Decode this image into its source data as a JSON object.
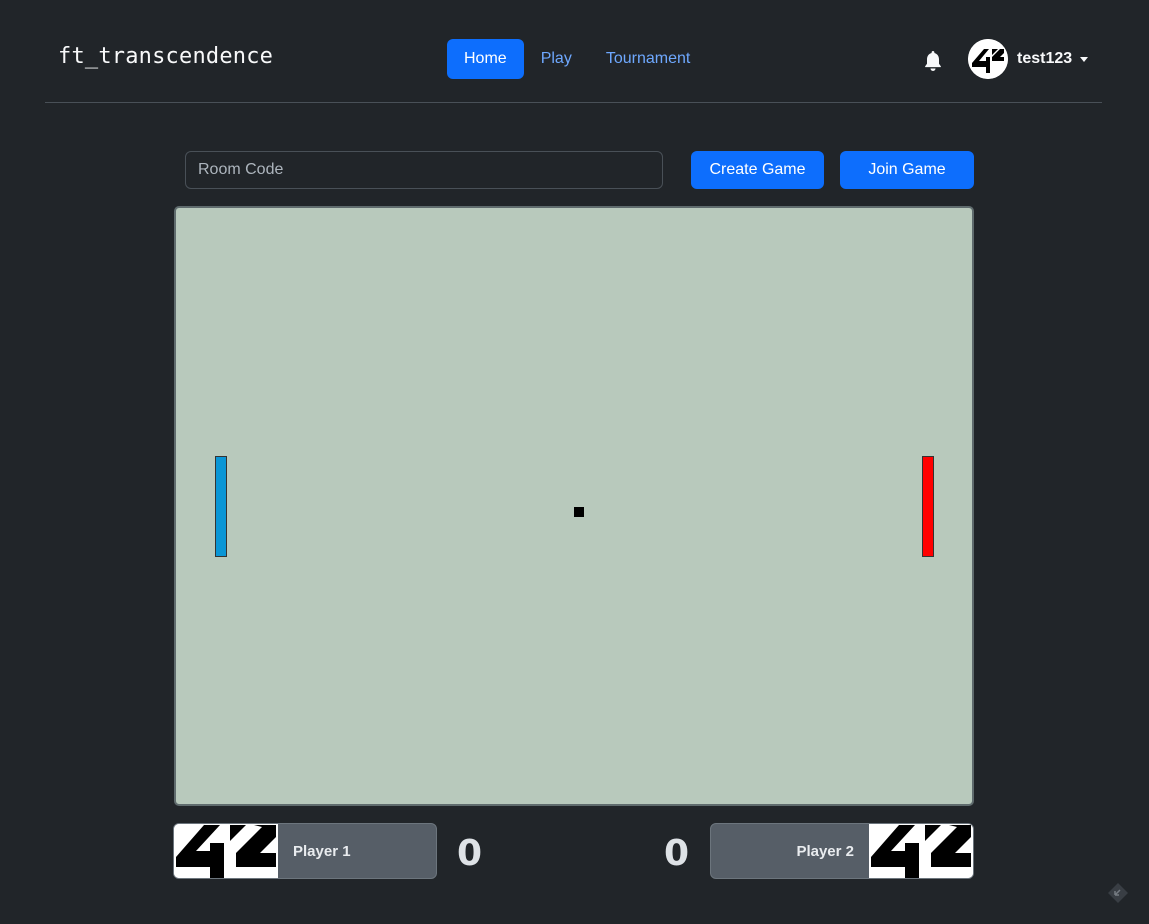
{
  "brand": "ft_transcendence",
  "nav": [
    {
      "label": "Home",
      "active": true
    },
    {
      "label": "Play",
      "active": false
    },
    {
      "label": "Tournament",
      "active": false
    }
  ],
  "user": {
    "name": "test123",
    "avatar_icon": "42-logo-icon"
  },
  "notifications_icon": "bell-icon",
  "room": {
    "placeholder": "Room Code",
    "value": ""
  },
  "buttons": {
    "create": "Create Game",
    "join": "Join Game"
  },
  "game": {
    "left_paddle_color": "#0a96d6",
    "right_paddle_color": "#ff0000",
    "board_color": "#b8c9bc"
  },
  "players": [
    {
      "name": "Player 1",
      "score": "0"
    },
    {
      "name": "Player 2",
      "score": "0"
    }
  ],
  "colors": {
    "accent": "#0d6efd",
    "background": "#212529"
  }
}
